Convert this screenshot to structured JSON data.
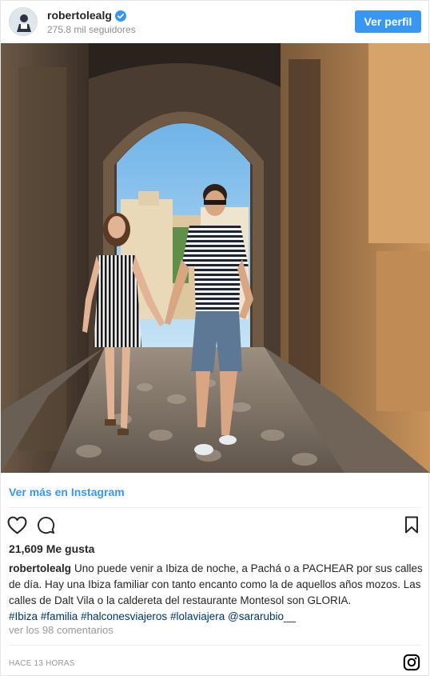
{
  "header": {
    "username": "robertolealg",
    "followers": "275.8 mil seguidores",
    "view_profile": "Ver perfil",
    "verified_icon": "verified-badge-icon",
    "avatar_icon": "profile-avatar-icon"
  },
  "photo": {
    "description_icon": "couple-walking-archway-photo"
  },
  "links": {
    "more_on_instagram": "Ver más en Instagram"
  },
  "actions": {
    "like_icon": "heart-icon",
    "comment_icon": "comment-icon",
    "save_icon": "bookmark-icon"
  },
  "likes": "21,609 Me gusta",
  "caption": {
    "username": "robertolealg",
    "text": "Uno puede venir a Ibiza de noche, a Pachá o a PACHEAR por sus calles de día. Hay una Ibiza familiar con tanto encanto como la de aquellos años mozos. Las calles de Dalt Vila o la caldereta del restaurante Montesol son GLORIA.",
    "tags": [
      "#Ibiza",
      "#familia",
      "#halconesviajeros",
      "#lolaviajera",
      "@sararubio__"
    ]
  },
  "comments_link": "ver los 98 comentarios",
  "timestamp": "HACE 13 HORAS",
  "footer": {
    "instagram_icon": "instagram-logo-icon"
  },
  "colors": {
    "accent": "#3897f0",
    "hashtag": "#003569",
    "muted": "#8e8e8e"
  }
}
